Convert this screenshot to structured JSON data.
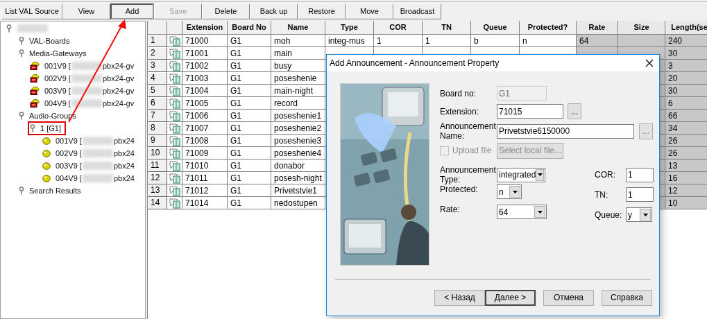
{
  "toolbar": [
    {
      "label": "List VAL Source",
      "pressed": false,
      "disabled": false
    },
    {
      "label": "View",
      "pressed": false,
      "disabled": false
    },
    {
      "label": "Add",
      "pressed": true,
      "disabled": false
    },
    {
      "label": "Save",
      "pressed": false,
      "disabled": true
    },
    {
      "label": "Delete",
      "pressed": false,
      "disabled": false
    },
    {
      "label": "Back up",
      "pressed": false,
      "disabled": false
    },
    {
      "label": "Restore",
      "pressed": false,
      "disabled": false
    },
    {
      "label": "Move",
      "pressed": false,
      "disabled": false
    },
    {
      "label": "Broadcast",
      "pressed": false,
      "disabled": false
    }
  ],
  "tree": {
    "kind": "root",
    "highlighted": false,
    "children": [
      {
        "kind": "folder",
        "label": "VAL-Boards",
        "highlighted": false
      },
      {
        "kind": "folder",
        "label": "Media-Gateways",
        "highlighted": false,
        "children": [
          {
            "kind": "gateway",
            "label": "001V9 [",
            "suffix": "pbx24-gv",
            "highlighted": false
          },
          {
            "kind": "gateway",
            "label": "002V9 [",
            "suffix": "pbx24-gv",
            "highlighted": false
          },
          {
            "kind": "gateway",
            "label": "003V9 [",
            "suffix": "pbx24-gv",
            "highlighted": false
          },
          {
            "kind": "gateway",
            "label": "004V9 [",
            "suffix": "pbx24-gv",
            "highlighted": false
          }
        ]
      },
      {
        "kind": "folder",
        "label": "Audio-Groups",
        "highlighted": false,
        "children": [
          {
            "kind": "folder",
            "label": "1 [G1]",
            "highlighted": true,
            "children": [
              {
                "kind": "board",
                "label": "001V9 [",
                "suffix": "pbx24",
                "highlighted": false
              },
              {
                "kind": "board",
                "label": "002V9 [",
                "suffix": "pbx24",
                "highlighted": false
              },
              {
                "kind": "board",
                "label": "003V9 [",
                "suffix": "pbx24",
                "highlighted": false
              },
              {
                "kind": "board",
                "label": "004V9 [",
                "suffix": "pbx24",
                "highlighted": false
              }
            ]
          }
        ]
      },
      {
        "kind": "folder",
        "label": "Search Results",
        "highlighted": false
      }
    ]
  },
  "table": {
    "columns": [
      {
        "label": "Extension",
        "shaded": false
      },
      {
        "label": "Board No",
        "shaded": false
      },
      {
        "label": "Name",
        "shaded": false
      },
      {
        "label": "Type",
        "shaded": false
      },
      {
        "label": "COR",
        "shaded": false
      },
      {
        "label": "TN",
        "shaded": false
      },
      {
        "label": "Queue",
        "shaded": false
      },
      {
        "label": "Protected?",
        "shaded": false
      },
      {
        "label": "Rate",
        "shaded": true
      },
      {
        "label": "Size",
        "shaded": true
      },
      {
        "label": "Length(se",
        "shaded": true
      }
    ],
    "rows": [
      {
        "number": "1",
        "extension": "71000",
        "board_no": "G1",
        "name": "moh",
        "type": "integ-mus",
        "cor": "1",
        "tn": "1",
        "queue": "b",
        "protected": "n",
        "rate": "64",
        "length": "240"
      },
      {
        "number": "2",
        "extension": "71001",
        "board_no": "G1",
        "name": "main",
        "length": "30"
      },
      {
        "number": "3",
        "extension": "71002",
        "board_no": "G1",
        "name": "busy",
        "length": "3"
      },
      {
        "number": "4",
        "extension": "71003",
        "board_no": "G1",
        "name": "poseshenie",
        "length": "20"
      },
      {
        "number": "5",
        "extension": "71004",
        "board_no": "G1",
        "name": "main-night",
        "length": "30"
      },
      {
        "number": "6",
        "extension": "71005",
        "board_no": "G1",
        "name": "record",
        "length": "6"
      },
      {
        "number": "7",
        "extension": "71006",
        "board_no": "G1",
        "name": "poseshenie1",
        "length": "66"
      },
      {
        "number": "8",
        "extension": "71007",
        "board_no": "G1",
        "name": "poseshenie2",
        "length": "34"
      },
      {
        "number": "9",
        "extension": "71008",
        "board_no": "G1",
        "name": "poseshenie3",
        "length": "26"
      },
      {
        "number": "10",
        "extension": "71009",
        "board_no": "G1",
        "name": "poseshenie4",
        "length": "26"
      },
      {
        "number": "11",
        "extension": "71010",
        "board_no": "G1",
        "name": "donabor",
        "length": "13"
      },
      {
        "number": "12",
        "extension": "71011",
        "board_no": "G1",
        "name": "posesh-night",
        "length": "16"
      },
      {
        "number": "13",
        "extension": "71012",
        "board_no": "G1",
        "name": "Privetstvie1",
        "length": "12"
      },
      {
        "number": "14",
        "extension": "71014",
        "board_no": "G1",
        "name": "nedostupen",
        "length": "10"
      }
    ]
  },
  "dialog": {
    "title": "Add Announcement - Announcement Property",
    "board_no": {
      "label": "Board no:",
      "value": "G1",
      "disabled": true
    },
    "extension": {
      "label": "Extension:",
      "value": "71015",
      "browse": "...",
      "browse_disabled": false
    },
    "announcement_name": {
      "label": "Announcement Name:",
      "value": "Privetstvie6150000",
      "browse": "...",
      "browse_disabled": true
    },
    "upload_file": {
      "label": "Upload file",
      "checked": false,
      "disabled": true
    },
    "select_file": {
      "label": "Select local file...",
      "disabled": true
    },
    "announcement_type": {
      "label": "Announcement Type:",
      "value": "integrated"
    },
    "protected": {
      "label": "Protected:",
      "value": "n"
    },
    "rate": {
      "label": "Rate:",
      "value": "64"
    },
    "cor": {
      "label": "COR:",
      "value": "1"
    },
    "tn": {
      "label": "TN:",
      "value": "1"
    },
    "queue": {
      "label": "Queue:",
      "value": "y"
    },
    "buttons": [
      {
        "label": "< Назад",
        "default": false
      },
      {
        "label": "Далее >",
        "default": true
      },
      {
        "label": "Отмена",
        "default": false
      },
      {
        "label": "Справка",
        "default": false
      }
    ]
  }
}
